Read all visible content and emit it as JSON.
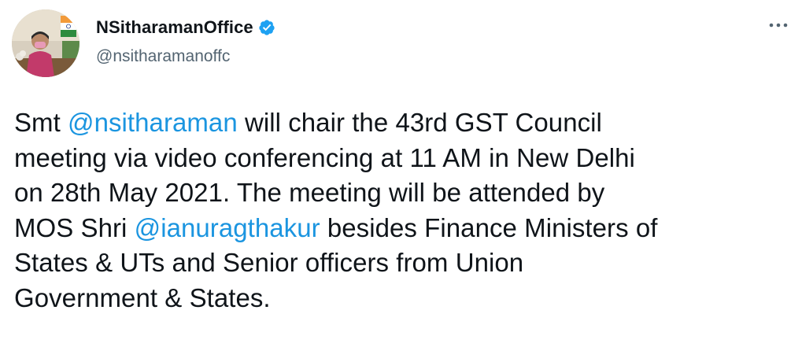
{
  "author": {
    "display_name": "NSitharamanOffice",
    "handle": "@nsitharamanoffc",
    "verified": true
  },
  "tweet": {
    "line1_pre": "Smt ",
    "mention1": "@nsitharaman",
    "line1_post": " will chair the 43rd GST Council",
    "line2": "meeting via video conferencing at 11 AM in New Delhi",
    "line3": "on 28th May 2021. The meeting will be attended by",
    "line4_pre": "MOS Shri ",
    "mention2": "@ianuragthakur",
    "line4_post": " besides Finance Ministers of",
    "line5": "States & UTs and Senior officers from Union",
    "line6": "Government & States."
  },
  "colors": {
    "mention": "#1b95e0",
    "verified_badge": "#1da1f2",
    "text": "#0f1419",
    "secondary_text": "#536471"
  },
  "icons": {
    "avatar": "profile-photo",
    "verified": "verified-badge-icon",
    "more": "more-options-icon"
  }
}
